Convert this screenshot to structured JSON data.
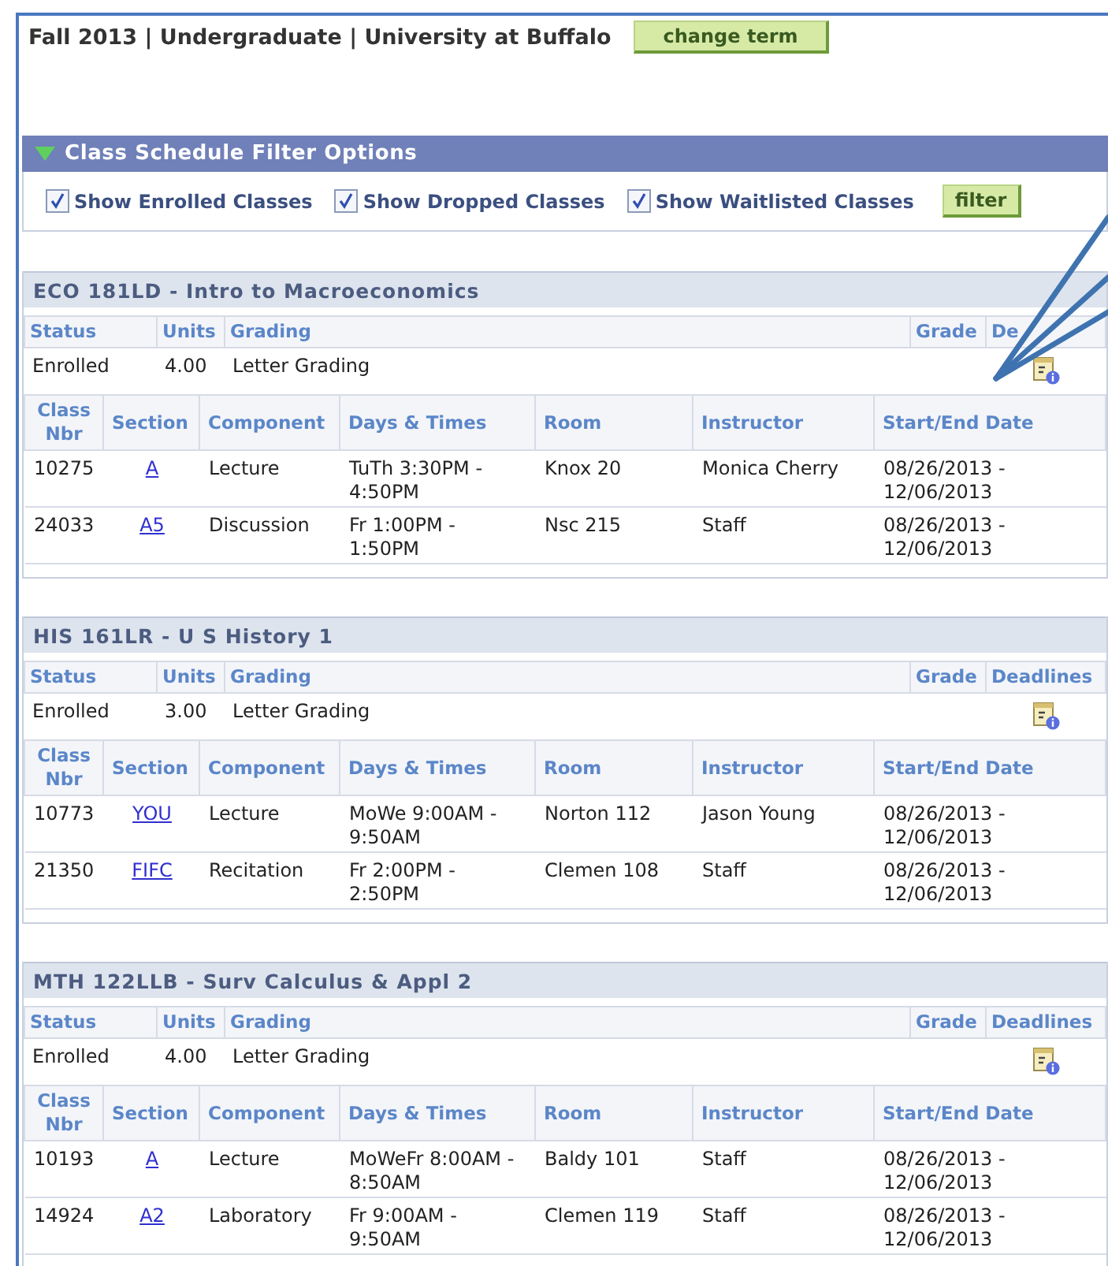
{
  "header": {
    "term": "Fall 2013 | Undergraduate | University at Buffalo",
    "button": "change term"
  },
  "filter": {
    "title": "Class Schedule Filter Options",
    "expanded": true,
    "options": [
      {
        "label": "Show Enrolled Classes",
        "checked": true
      },
      {
        "label": "Show Dropped Classes",
        "checked": true
      },
      {
        "label": "Show Waitlisted Classes",
        "checked": true
      }
    ],
    "button": "filter"
  },
  "courses": [
    {
      "title": "ECO 181LD - Intro to Macroeconomics",
      "summary_columns": [
        "Status",
        "Units",
        "Grading",
        "Grade",
        "De"
      ],
      "summary": {
        "status": "Enrolled",
        "units": "4.00",
        "grading": "Letter Grading"
      },
      "columns": [
        "Class Nbr",
        "Section",
        "Component",
        "Days & Times",
        "Room",
        "Instructor",
        "Start/End Date"
      ],
      "sections": [
        {
          "class_nbr": "10275",
          "section": "A",
          "component": "Lecture",
          "days_times": "TuTh 3:30PM - 4:50PM",
          "room": "Knox 20",
          "instructor": "Monica Cherry",
          "dates": "08/26/2013 - 12/06/2013"
        },
        {
          "class_nbr": "24033",
          "section": "A5",
          "component": "Discussion",
          "days_times": "Fr 1:00PM - 1:50PM",
          "room": "Nsc 215",
          "instructor": "Staff",
          "dates": "08/26/2013 - 12/06/2013"
        }
      ]
    },
    {
      "title": "HIS 161LR - U S History 1",
      "summary_columns": [
        "Status",
        "Units",
        "Grading",
        "Grade",
        "Deadlines"
      ],
      "summary": {
        "status": "Enrolled",
        "units": "3.00",
        "grading": "Letter Grading"
      },
      "columns": [
        "Class Nbr",
        "Section",
        "Component",
        "Days & Times",
        "Room",
        "Instructor",
        "Start/End Date"
      ],
      "sections": [
        {
          "class_nbr": "10773",
          "section": "YOU",
          "component": "Lecture",
          "days_times": "MoWe 9:00AM - 9:50AM",
          "room": "Norton 112",
          "instructor": "Jason Young",
          "dates": "08/26/2013 - 12/06/2013"
        },
        {
          "class_nbr": "21350",
          "section": "FIFC",
          "component": "Recitation",
          "days_times": "Fr 2:00PM - 2:50PM",
          "room": "Clemen 108",
          "instructor": "Staff",
          "dates": "08/26/2013 - 12/06/2013"
        }
      ]
    },
    {
      "title": "MTH 122LLB - Surv Calculus & Appl 2",
      "summary_columns": [
        "Status",
        "Units",
        "Grading",
        "Grade",
        "Deadlines"
      ],
      "summary": {
        "status": "Enrolled",
        "units": "4.00",
        "grading": "Letter Grading"
      },
      "columns": [
        "Class Nbr",
        "Section",
        "Component",
        "Days & Times",
        "Room",
        "Instructor",
        "Start/End Date"
      ],
      "sections": [
        {
          "class_nbr": "10193",
          "section": "A",
          "component": "Lecture",
          "days_times": "MoWeFr 8:00AM - 8:50AM",
          "room": "Baldy 101",
          "instructor": "Staff",
          "dates": "08/26/2013 - 12/06/2013"
        },
        {
          "class_nbr": "14924",
          "section": "A2",
          "component": "Laboratory",
          "days_times": "Fr 9:00AM - 9:50AM",
          "room": "Clemen 119",
          "instructor": "Staff",
          "dates": "08/26/2013 - 12/06/2013"
        }
      ]
    }
  ]
}
